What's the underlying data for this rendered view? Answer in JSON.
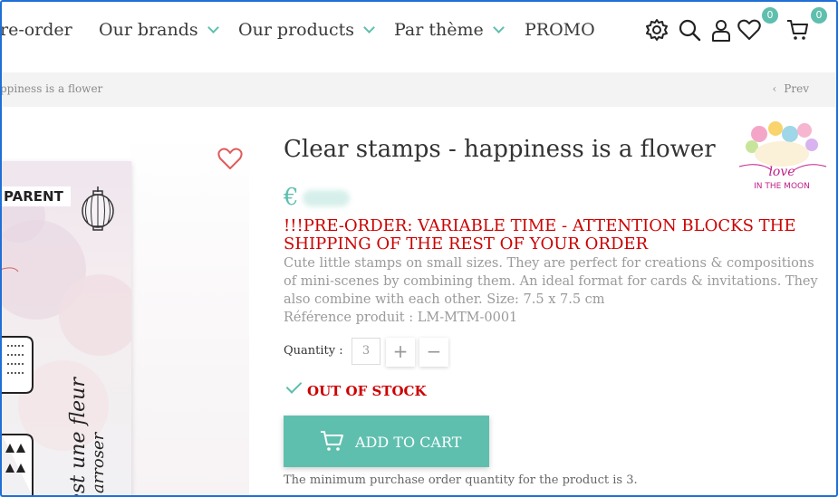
{
  "nav": {
    "items": [
      {
        "label": "re-order"
      },
      {
        "label": "Our brands"
      },
      {
        "label": "Our products"
      },
      {
        "label": "Par thème"
      },
      {
        "label": "PROMO"
      }
    ],
    "icons": [
      "gear-icon",
      "search-icon",
      "user-icon",
      "heart-icon",
      "cart-icon"
    ],
    "wishlist_count": "0",
    "cart_count": "0"
  },
  "breadcrumb": {
    "current": "ppiness is a flower",
    "prev_label": "Prev"
  },
  "product_image": {
    "tag": "PARENT",
    "handwriting_1": "est une fleur",
    "handwriting_2": "t arroser"
  },
  "product": {
    "title": "Clear stamps - happiness is a flower",
    "currency": "€",
    "preorder_notice": "!!!PRE-ORDER: VARIABLE TIME - ATTENTION BLOCKS THE SHIPPING OF THE REST OF YOUR ORDER",
    "description": "Cute little stamps on small sizes. They are perfect for creations & compositions of mini-scenes by combining them. An ideal format for cards & invitations. They also combine with each other. Size: 7.5 x 7.5 cm",
    "reference": "Référence produit : LM-MTM-0001",
    "quantity_label": "Quantity :",
    "quantity_value": "3",
    "plus": "+",
    "minus": "−",
    "stock_status": "OUT OF STOCK",
    "add_to_cart": "ADD TO CART",
    "min_qty_note": "The minimum purchase order quantity for the product is 3."
  },
  "brand_logo": {
    "line1": "love",
    "line2": "IN THE MOON"
  },
  "colors": {
    "accent": "#5fbfae",
    "alert": "#cc0000",
    "frame": "#1f6fd6"
  }
}
